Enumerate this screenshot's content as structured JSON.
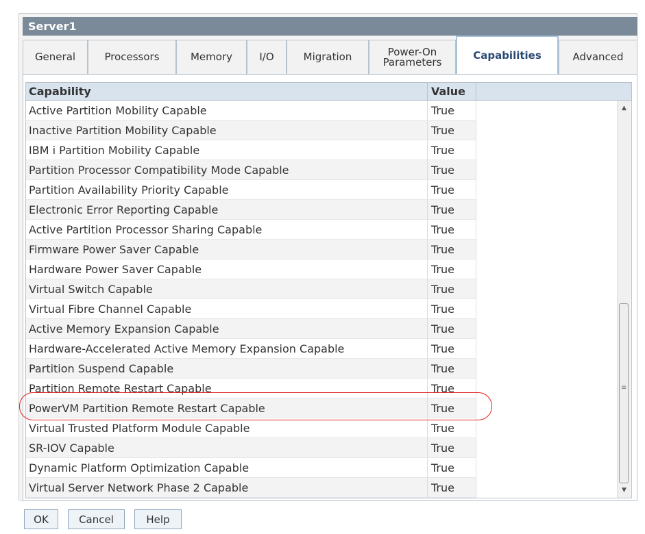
{
  "window": {
    "title": "Server1"
  },
  "tabs": [
    {
      "label": "General",
      "active": false
    },
    {
      "label": "Processors",
      "active": false
    },
    {
      "label": "Memory",
      "active": false
    },
    {
      "label": "I/O",
      "active": false
    },
    {
      "label": "Migration",
      "active": false
    },
    {
      "label": "Power-On Parameters",
      "active": false
    },
    {
      "label": "Capabilities",
      "active": true
    },
    {
      "label": "Advanced",
      "active": false
    }
  ],
  "table": {
    "columns": [
      "Capability",
      "Value"
    ],
    "rows": [
      {
        "capability": "Active Partition Mobility Capable",
        "value": "True"
      },
      {
        "capability": "Inactive Partition Mobility Capable",
        "value": "True"
      },
      {
        "capability": "IBM i Partition Mobility Capable",
        "value": "True"
      },
      {
        "capability": "Partition Processor Compatibility Mode Capable",
        "value": "True"
      },
      {
        "capability": "Partition Availability Priority Capable",
        "value": "True"
      },
      {
        "capability": "Electronic Error Reporting Capable",
        "value": "True"
      },
      {
        "capability": "Active Partition Processor Sharing Capable",
        "value": "True"
      },
      {
        "capability": "Firmware Power Saver Capable",
        "value": "True"
      },
      {
        "capability": "Hardware Power Saver Capable",
        "value": "True"
      },
      {
        "capability": "Virtual Switch Capable",
        "value": "True"
      },
      {
        "capability": "Virtual Fibre Channel Capable",
        "value": "True"
      },
      {
        "capability": "Active Memory Expansion Capable",
        "value": "True"
      },
      {
        "capability": "Hardware-Accelerated Active Memory Expansion Capable",
        "value": "True"
      },
      {
        "capability": "Partition Suspend Capable",
        "value": "True"
      },
      {
        "capability": "Partition Remote Restart Capable",
        "value": "True"
      },
      {
        "capability": "PowerVM Partition Remote Restart Capable",
        "value": "True"
      },
      {
        "capability": "Virtual Trusted Platform Module Capable",
        "value": "True"
      },
      {
        "capability": "SR-IOV Capable",
        "value": "True"
      },
      {
        "capability": "Dynamic Platform Optimization Capable",
        "value": "True"
      },
      {
        "capability": "Virtual Server Network Phase 2 Capable",
        "value": "True"
      }
    ]
  },
  "buttons": {
    "ok": "OK",
    "cancel": "Cancel",
    "help": "Help"
  },
  "colors": {
    "titlebar": "#7a8a99",
    "header": "#d9e3ee",
    "highlight": "#e0211d",
    "active_tab_text": "#2a4a74"
  }
}
